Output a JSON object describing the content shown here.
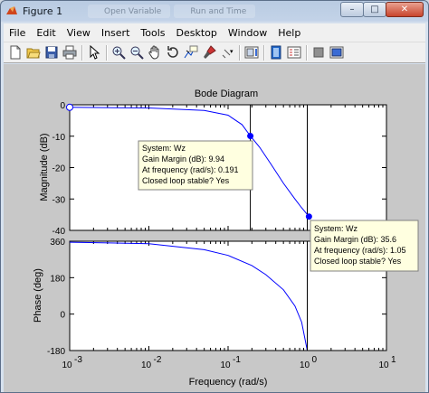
{
  "window": {
    "title": "Figure 1",
    "bg_tabs": [
      "Open Variable",
      "Run and Time"
    ],
    "buttons": {
      "minimize": "–",
      "maximize": "□",
      "close": "✕"
    }
  },
  "menu": [
    "File",
    "Edit",
    "View",
    "Insert",
    "Tools",
    "Desktop",
    "Window",
    "Help"
  ],
  "toolbar": [
    "new-figure-icon",
    "open-file-icon",
    "save-icon",
    "print-icon",
    "pointer-icon",
    "zoom-in-icon",
    "zoom-out-icon",
    "pan-hand-icon",
    "rotate-3d-icon",
    "data-cursor-icon",
    "brush-icon",
    "link-plot-icon",
    "colorbar-icon",
    "legend-icon",
    "hide-plot-tools-icon",
    "show-plot-tools-icon"
  ],
  "chart_data": {
    "type": "line",
    "title": "Bode Diagram",
    "xlabel": "Frequency  (rad/s)",
    "xscale": "log",
    "xlim": [
      0.001,
      10
    ],
    "xticks": [
      {
        "v": 0.001,
        "base": "10",
        "exp": "-3"
      },
      {
        "v": 0.01,
        "base": "10",
        "exp": "-2"
      },
      {
        "v": 0.1,
        "base": "10",
        "exp": "-1"
      },
      {
        "v": 1,
        "base": "10",
        "exp": "0"
      },
      {
        "v": 10,
        "base": "10",
        "exp": "1"
      }
    ],
    "magnitude": {
      "ylabel": "Magnitude (dB)",
      "ylim": [
        -40,
        0
      ],
      "yticks": [
        "0",
        "-10",
        "-20",
        "-30",
        "-40"
      ],
      "series": [
        {
          "x": [
            0.001,
            0.01,
            0.05,
            0.1,
            0.15,
            0.191,
            0.25,
            0.35,
            0.5,
            0.7,
            0.85,
            1.05
          ],
          "y": [
            -0.8,
            -1.0,
            -1.8,
            -3.3,
            -6.3,
            -9.94,
            -13.5,
            -19.0,
            -25.0,
            -30.0,
            -32.8,
            -35.6
          ]
        }
      ]
    },
    "phase": {
      "ylabel": "Phase (deg)",
      "ylim": [
        -180,
        360
      ],
      "yticks": [
        "360",
        "180",
        "0",
        "-180"
      ],
      "series": [
        {
          "x": [
            0.001,
            0.01,
            0.05,
            0.1,
            0.2,
            0.3,
            0.5,
            0.7,
            0.85,
            1.0
          ],
          "y": [
            355,
            348,
            318,
            290,
            240,
            195,
            120,
            40,
            -40,
            -180
          ]
        }
      ]
    },
    "vlines": [
      0.191,
      1.0
    ],
    "markers": [
      {
        "panel": "magnitude",
        "x": 0.001,
        "y": -0.8,
        "style": "open"
      },
      {
        "panel": "magnitude",
        "x": 0.191,
        "y": -9.94,
        "style": "filled"
      },
      {
        "panel": "magnitude",
        "x": 1.05,
        "y": -35.6,
        "style": "filled"
      }
    ],
    "datatips": [
      {
        "lines": [
          "System: Wz",
          "Gain Margin (dB): 9.94",
          "At frequency (rad/s): 0.191",
          "Closed loop stable? Yes"
        ]
      },
      {
        "lines": [
          "System: Wz",
          "Gain Margin (dB): 35.6",
          "At frequency (rad/s): 1.05",
          "Closed loop stable? Yes"
        ]
      }
    ],
    "line_color": "#0000ff"
  }
}
